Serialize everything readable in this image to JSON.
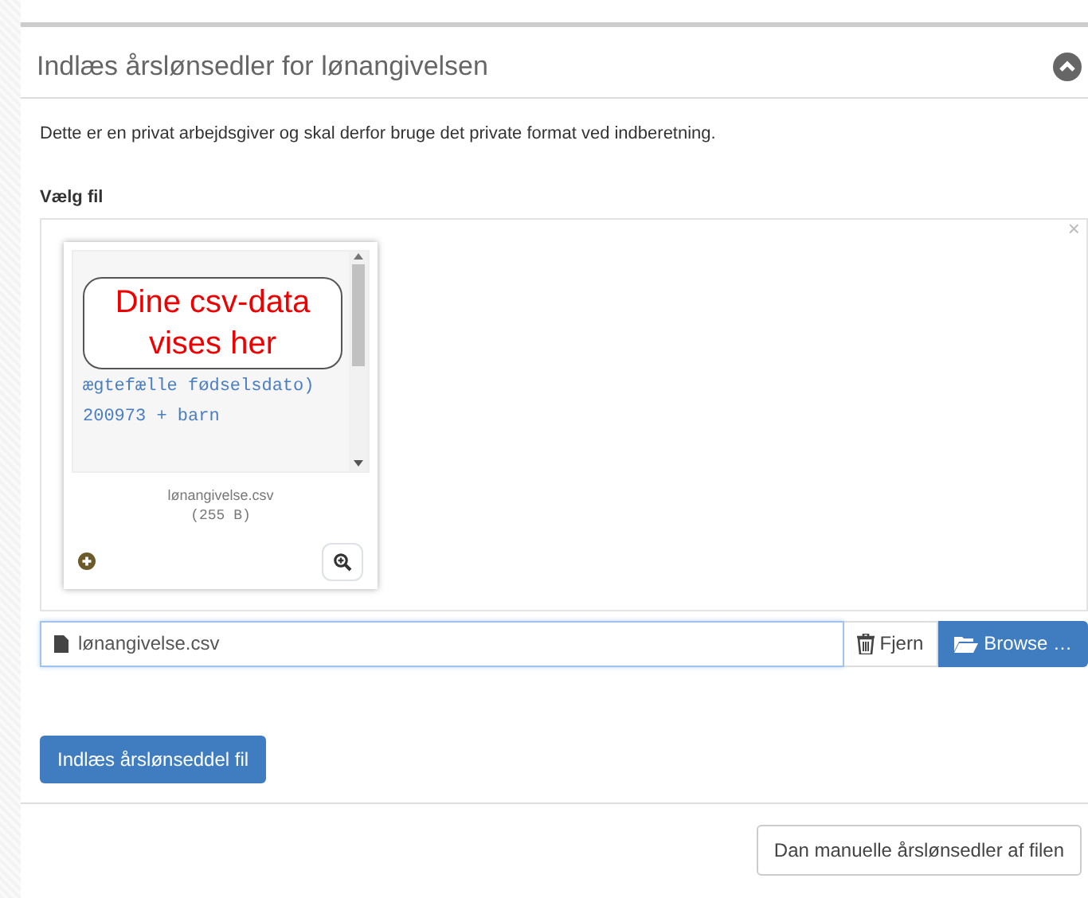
{
  "panel": {
    "title": "Indlæs årslønsedler for lønangivelsen",
    "collapsed": false
  },
  "intro": "Dette er en privat arbejdsgiver og skal derfor bruge det private format ved indberetning.",
  "file_label": "Vælg fil",
  "dropzone": {
    "close": "×",
    "preview": {
      "callout": "Dine csv-data vises her",
      "lines": [
        "ægtefælle fødselsdato)",
        "200973 + barn"
      ],
      "file_name": "lønangivelse.csv",
      "file_size": "(255 B)"
    }
  },
  "file_input": {
    "value": "lønangivelse.csv",
    "remove_label": "Fjern",
    "browse_label": "Browse …"
  },
  "submit_label": "Indlæs årslønseddel fil",
  "footer_button": "Dan manuelle årslønsedler af filen"
}
